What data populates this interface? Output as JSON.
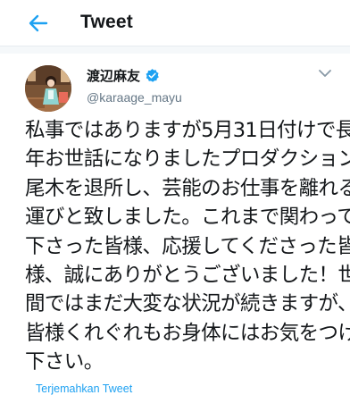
{
  "header": {
    "title": "Tweet",
    "back_icon": "arrow-left-icon",
    "accent_color": "#1da1f2"
  },
  "author": {
    "display_name": "渡辺麻友",
    "handle": "@karaage_mayu",
    "verified": true,
    "verified_icon": "verified-badge-icon",
    "menu_icon": "chevron-down-icon"
  },
  "tweet": {
    "lines": [
      "私事ではありますが5月31日付けで長",
      "年お世話になりましたプロダクション",
      "尾木を退所し、芸能のお仕事を離れる",
      "運びと致しました。これまで関わって",
      "下さった皆様、応援してくださった皆",
      "様、誠にありがとうございました！世",
      "間ではまだ大変な状況が続きますが、",
      "皆様くれぐれもお身体にはお気をつけ",
      "下さい。"
    ]
  },
  "translate": {
    "label": "Terjemahkan Tweet"
  }
}
